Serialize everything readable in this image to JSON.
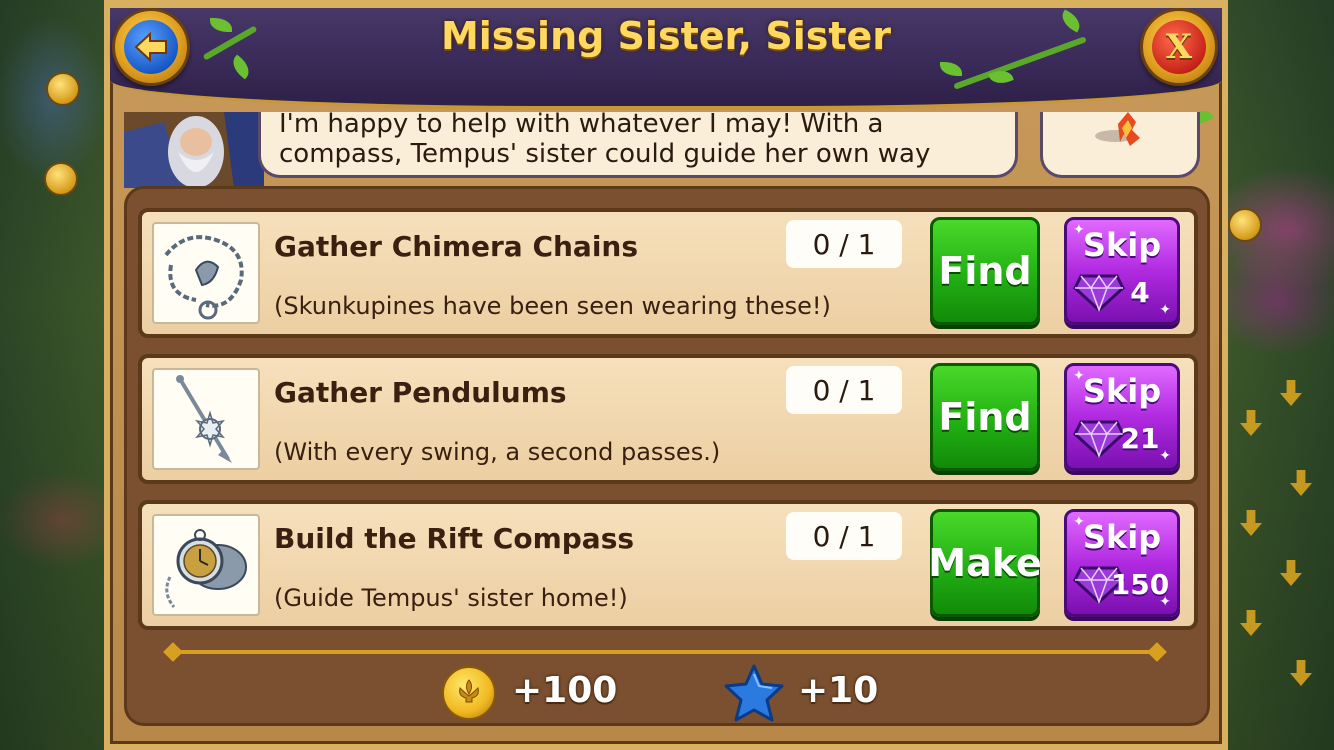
{
  "dialog": {
    "title": "Missing Sister, Sister",
    "dialogue_line1": "I'm happy to help with whatever I may! With a",
    "dialogue_line2": "compass, Tempus' sister could guide her own way"
  },
  "tasks": [
    {
      "title": "Gather Chimera Chains",
      "subtitle": "(Skunkupines have been seen wearing these!)",
      "progress": "0 / 1",
      "action_label": "Find",
      "skip_label": "Skip",
      "skip_cost": "4",
      "icon": "chain-icon"
    },
    {
      "title": "Gather Pendulums",
      "subtitle": "(With every swing, a second passes.)",
      "progress": "0 / 1",
      "action_label": "Find",
      "skip_label": "Skip",
      "skip_cost": "21",
      "icon": "pendulum-icon"
    },
    {
      "title": "Build the Rift Compass",
      "subtitle": "(Guide Tempus' sister home!)",
      "progress": "0 / 1",
      "action_label": "Make",
      "skip_label": "Skip",
      "skip_cost": "150",
      "icon": "pocket-watch-icon"
    }
  ],
  "rewards": {
    "coins": "+100",
    "stars": "+10"
  },
  "colors": {
    "header": "#3a2a58",
    "title": "#ffd860",
    "action_green": "#22b014",
    "skip_purple": "#b02ae0",
    "task_bg": "#f6e0bc"
  }
}
